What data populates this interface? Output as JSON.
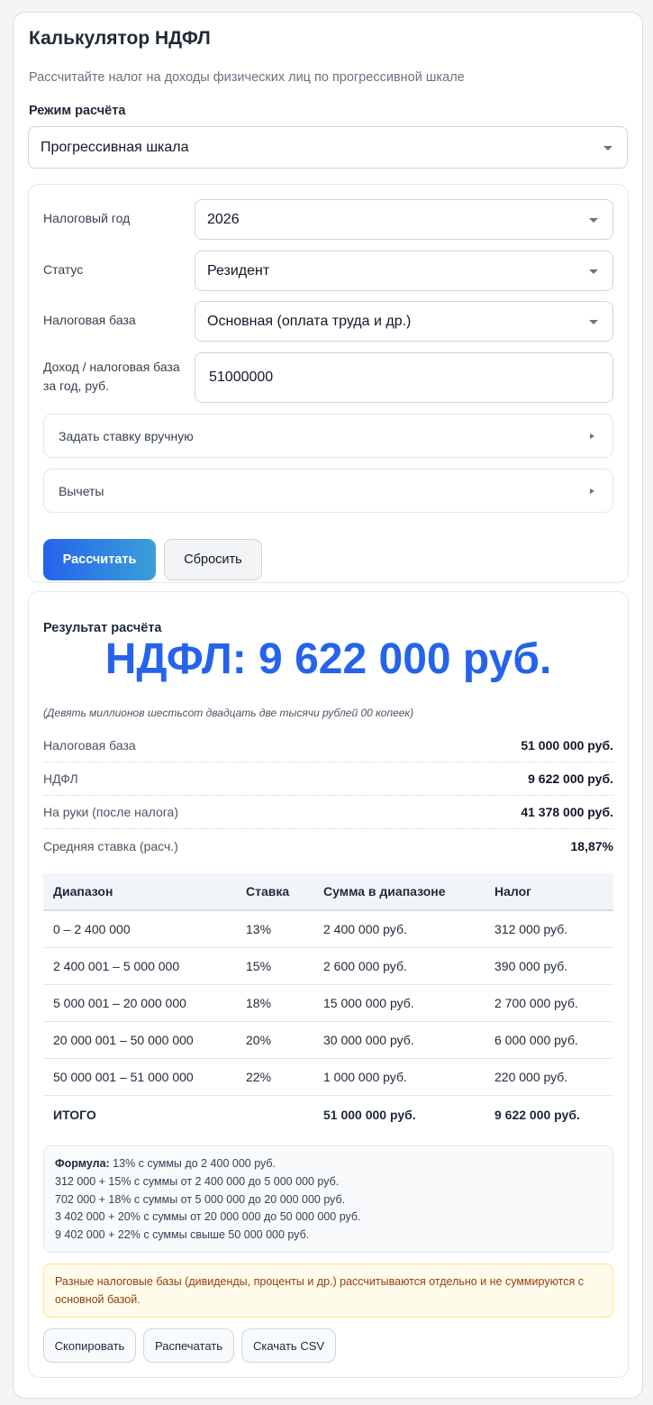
{
  "header": {
    "title": "Калькулятор НДФЛ",
    "subtitle": "Рассчитайте налог на доходы физических лиц по прогрессивной шкале"
  },
  "mode": {
    "label": "Режим расчёта",
    "value": "Прогрессивная шкала"
  },
  "form": {
    "year": {
      "label": "Налоговый год",
      "value": "2026"
    },
    "status": {
      "label": "Статус",
      "value": "Резидент"
    },
    "base_type": {
      "label": "Налоговая база",
      "value": "Основная (оплата труда и др.)"
    },
    "income": {
      "label_line1": "Доход / налоговая база",
      "label_line2": "за год, руб.",
      "value": "51000000"
    },
    "manual_rate_label": "Задать ставку вручную",
    "deductions_label": "Вычеты",
    "calculate_label": "Рассчитать",
    "reset_label": "Сбросить"
  },
  "result": {
    "heading": "Результат расчёта",
    "tax_big": "НДФЛ: 9 622 000 руб.",
    "tax_words": "(Девять миллионов шестьсот двадцать две тысячи рублей 00 копеек)",
    "summary": [
      {
        "key": "Налоговая база",
        "value": "51 000 000 руб."
      },
      {
        "key": "НДФЛ",
        "value": "9 622 000 руб."
      },
      {
        "key": "На руки (после налога)",
        "value": "41 378 000 руб."
      },
      {
        "key": "Средняя ставка (расч.)",
        "value": "18,87%"
      }
    ],
    "table": {
      "headers": [
        "Диапазон",
        "Ставка",
        "Сумма в диапазоне",
        "Налог"
      ],
      "rows": [
        [
          "0 – 2 400 000",
          "13%",
          "2 400 000 руб.",
          "312 000 руб."
        ],
        [
          "2 400 001 – 5 000 000",
          "15%",
          "2 600 000 руб.",
          "390 000 руб."
        ],
        [
          "5 000 001 – 20 000 000",
          "18%",
          "15 000 000 руб.",
          "2 700 000 руб."
        ],
        [
          "20 000 001 – 50 000 000",
          "20%",
          "30 000 000 руб.",
          "6 000 000 руб."
        ],
        [
          "50 000 001 – 51 000 000",
          "22%",
          "1 000 000 руб.",
          "220 000 руб."
        ]
      ],
      "total": [
        "ИТОГО",
        "",
        "51 000 000 руб.",
        "9 622 000 руб."
      ]
    },
    "formula": {
      "label": "Формула:",
      "line1": " 13% с суммы до 2 400 000 руб.",
      "line2": "312 000 + 15% с суммы от 2 400 000 до 5 000 000 руб.",
      "line3": "702 000 + 18% с суммы от 5 000 000 до 20 000 000 руб.",
      "line4": "3 402 000 + 20% с суммы от 20 000 000 до 50 000 000 руб.",
      "line5": "9 402 000 + 22% с суммы свыше 50 000 000 руб."
    },
    "note": "Разные налоговые базы (дивиденды, проценты и др.) рассчитываются отдельно и не суммируются с основной базой.",
    "actions": {
      "copy": "Скопировать",
      "print": "Распечатать",
      "csv": "Скачать CSV"
    }
  },
  "colors": {
    "accent": "#2563eb",
    "note_bg": "#fffbeb",
    "note_text": "#92400e"
  }
}
